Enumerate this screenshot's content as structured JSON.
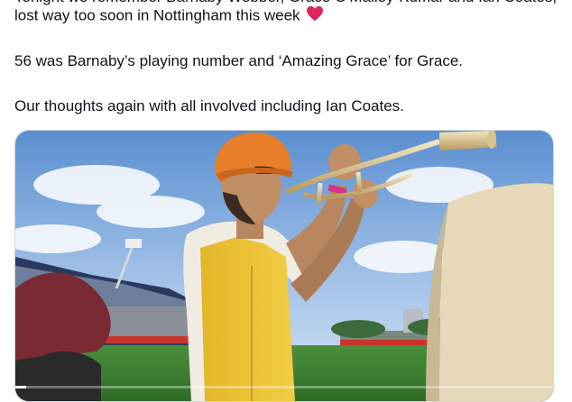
{
  "tweet": {
    "lines": [
      "Tonight we remember Barnaby Webber, Grace O'Malley-Kumar and Ian Coates,",
      "lost way too soon in Nottingham this week",
      "56 was Barnaby’s playing number and ‘Amazing Grace’ for Grace.",
      "Our thoughts again with all involved including Ian Coates."
    ],
    "heart_icon": "red-heart-icon",
    "heart_color": "#e0245e"
  },
  "media": {
    "type": "video",
    "icon": "video-player",
    "progress_fraction": 0.02
  }
}
